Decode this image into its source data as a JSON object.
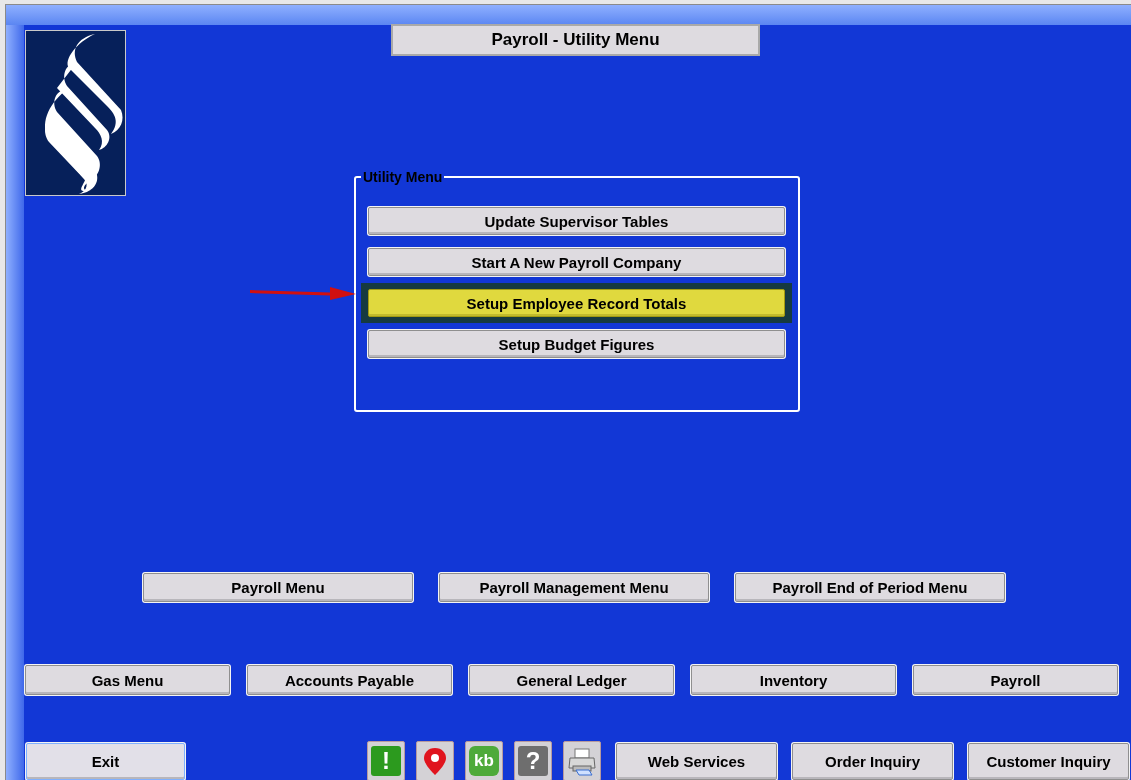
{
  "window": {
    "title": "Payroll - Utility Menu"
  },
  "utility_menu": {
    "title": "Utility Menu",
    "buttons": [
      {
        "label": "Update Supervisor Tables",
        "selected": false
      },
      {
        "label": "Start A New Payroll Company",
        "selected": false
      },
      {
        "label": "Setup Employee Record Totals",
        "selected": true
      },
      {
        "label": "Setup Budget Figures",
        "selected": false
      }
    ]
  },
  "submenu_buttons": [
    "Payroll Menu",
    "Payroll Management Menu",
    "Payroll End of Period Menu"
  ],
  "module_buttons": [
    "Gas Menu",
    "Accounts Payable",
    "General Ledger",
    "Inventory",
    "Payroll"
  ],
  "footer": {
    "exit": "Exit",
    "tools": [
      {
        "kind": "alert",
        "glyph": "!"
      },
      {
        "kind": "location"
      },
      {
        "kind": "kb",
        "glyph": "kb"
      },
      {
        "kind": "help",
        "glyph": "?"
      },
      {
        "kind": "print"
      }
    ],
    "links": [
      "Web Services",
      "Order Inquiry",
      "Customer Inquiry"
    ]
  }
}
